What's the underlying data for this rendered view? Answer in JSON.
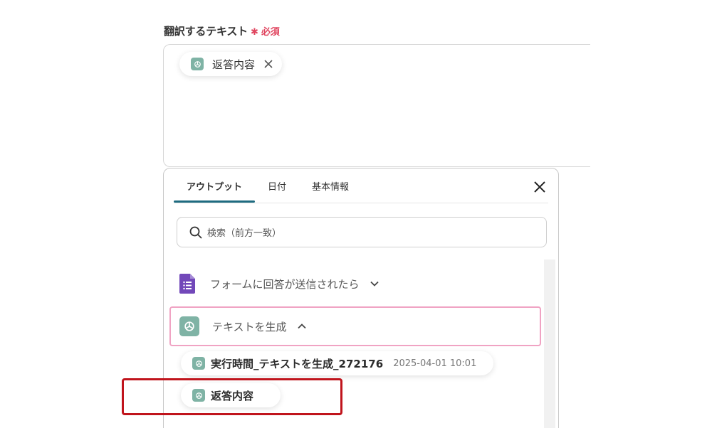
{
  "field": {
    "label": "翻訳するテキスト",
    "required_mark": "✱ 必須"
  },
  "textarea": {
    "token_label": "返答内容"
  },
  "panel": {
    "tabs": [
      {
        "label": "アウトプット",
        "active": true
      },
      {
        "label": "日付",
        "active": false
      },
      {
        "label": "基本情報",
        "active": false
      }
    ],
    "search": {
      "placeholder": "検索（前方一致）"
    },
    "groups": [
      {
        "label": "フォームに回答が送信されたら",
        "icon": "google-forms-icon",
        "expanded": false
      },
      {
        "label": "テキストを生成",
        "icon": "chatgpt-icon",
        "expanded": true
      }
    ],
    "outputs": [
      {
        "label": "実行時間_テキストを生成_272176",
        "value": "2025-04-01 10:01"
      },
      {
        "label": "返答内容",
        "value": ""
      }
    ]
  },
  "colors": {
    "accent": "#1e6b80",
    "required": "#e0455f",
    "highlight_border": "#c0141c",
    "group_highlight": "#f0a3c3",
    "ai_icon_bg": "#7fb3a5",
    "forms_purple": "#7248b9"
  }
}
